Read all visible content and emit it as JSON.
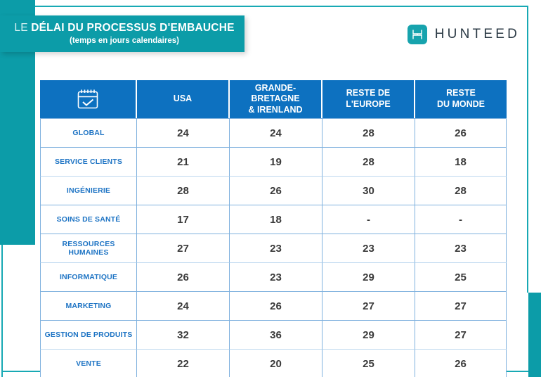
{
  "header": {
    "title_prefix": "LE ",
    "title_main": "DÉLAI DU PROCESSUS D'EMBAUCHE",
    "subtitle": "(temps en jours calendaires)"
  },
  "brand": {
    "name": "HUNTEED",
    "mark_icon": "hunteed-h-icon"
  },
  "colors": {
    "teal": "#0C9CA8",
    "header_blue": "#0D71C0",
    "label_blue": "#1E74C4",
    "grid_blue": "#7FB1DE",
    "value_gray": "#3A3A3A"
  },
  "chart_data": {
    "type": "table",
    "title": "LE DÉLAI DU PROCESSUS D'EMBAUCHE",
    "subtitle": "(temps en jours calendaires)",
    "corner_icon": "calendar-check-icon",
    "columns": [
      "",
      "USA",
      "GRANDE-BRETAGNE\n& IRENLAND",
      "RESTE DE\nL'EUROPE",
      "RESTE\nDU MONDE"
    ],
    "column_headers": [
      {
        "line1": "USA",
        "line2": ""
      },
      {
        "line1": "GRANDE-BRETAGNE",
        "line2": "& IRENLAND"
      },
      {
        "line1": "RESTE DE",
        "line2": "L'EUROPE"
      },
      {
        "line1": "RESTE",
        "line2": "DU MONDE"
      }
    ],
    "categories": [
      "GLOBAL",
      "SERVICE CLIENTS",
      "INGÉNIERIE",
      "SOINS DE SANTÉ",
      "RESSOURCES HUMAINES",
      "INFORMATIQUE",
      "MARKETING",
      "GESTION DE PRODUITS",
      "VENTE"
    ],
    "series": [
      {
        "name": "USA",
        "values": [
          24,
          21,
          28,
          17,
          27,
          26,
          24,
          32,
          22
        ]
      },
      {
        "name": "GRANDE-BRETAGNE & IRENLAND",
        "values": [
          24,
          19,
          26,
          18,
          23,
          23,
          26,
          36,
          20
        ]
      },
      {
        "name": "RESTE DE L'EUROPE",
        "values": [
          28,
          28,
          30,
          "-",
          23,
          29,
          27,
          29,
          25
        ]
      },
      {
        "name": "RESTE DU MONDE",
        "values": [
          26,
          18,
          28,
          "-",
          23,
          25,
          27,
          27,
          26
        ]
      }
    ],
    "rows": [
      {
        "label": "GLOBAL",
        "cells": [
          "24",
          "24",
          "28",
          "26"
        ]
      },
      {
        "label": "SERVICE CLIENTS",
        "cells": [
          "21",
          "19",
          "28",
          "18"
        ]
      },
      {
        "label": "INGÉNIERIE",
        "cells": [
          "28",
          "26",
          "30",
          "28"
        ]
      },
      {
        "label": "SOINS DE SANTÉ",
        "cells": [
          "17",
          "18",
          "-",
          "-"
        ]
      },
      {
        "label": "RESSOURCES HUMAINES",
        "cells": [
          "27",
          "23",
          "23",
          "23"
        ]
      },
      {
        "label": "INFORMATIQUE",
        "cells": [
          "26",
          "23",
          "29",
          "25"
        ]
      },
      {
        "label": "MARKETING",
        "cells": [
          "24",
          "26",
          "27",
          "27"
        ]
      },
      {
        "label": "GESTION DE PRODUITS",
        "cells": [
          "32",
          "36",
          "29",
          "27"
        ]
      },
      {
        "label": "VENTE",
        "cells": [
          "22",
          "20",
          "25",
          "26"
        ]
      }
    ],
    "unit": "jours calendaires",
    "missing_value_marker": "-"
  }
}
